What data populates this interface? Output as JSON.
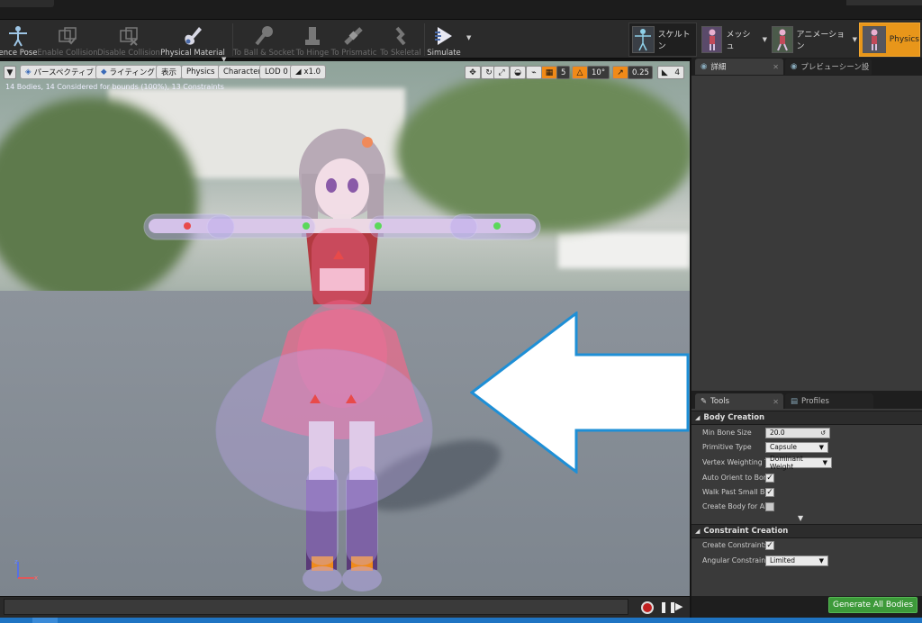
{
  "toolbar": {
    "items": [
      {
        "label": "ence Pose",
        "icon": "reference-pose-icon",
        "enabled": true
      },
      {
        "label": "Enable Collision",
        "icon": "enable-collision-icon",
        "enabled": false
      },
      {
        "label": "Disable Collision",
        "icon": "disable-collision-icon",
        "enabled": false
      },
      {
        "label": "Physical Material",
        "icon": "physical-material-icon",
        "enabled": true
      },
      {
        "label": "To Ball & Socket",
        "icon": "ball-socket-icon",
        "enabled": false
      },
      {
        "label": "To Hinge",
        "icon": "hinge-icon",
        "enabled": false
      },
      {
        "label": "To Prismatic",
        "icon": "prismatic-icon",
        "enabled": false
      },
      {
        "label": "To Skeletal",
        "icon": "skeletal-icon",
        "enabled": false
      },
      {
        "label": "Simulate",
        "icon": "simulate-icon",
        "enabled": true
      }
    ],
    "modes": [
      {
        "label": "スケルトン",
        "icon": "skeleton-mode-icon"
      },
      {
        "label": "メッシュ",
        "icon": "mesh-mode-icon"
      },
      {
        "label": "アニメーション",
        "icon": "animation-mode-icon"
      },
      {
        "label": "Physics",
        "icon": "physics-mode-icon",
        "active": true
      }
    ]
  },
  "viewport": {
    "left_buttons": [
      "パースペクティブ",
      "ライティング",
      "表示",
      "Physics",
      "Character",
      "LOD 0",
      "x1.0"
    ],
    "grid_snap": "5",
    "rotation_snap": "10°",
    "scale_snap": "0.25",
    "camera_speed": "4",
    "stats": "14 Bodies, 14 Considered for bounds (100%), 13 Constraints"
  },
  "panels": {
    "top_tabs": [
      "詳細",
      "プレビューシーン設"
    ],
    "bottom_tabs": [
      "Tools",
      "Profiles"
    ]
  },
  "body_creation": {
    "title": "Body Creation",
    "min_bone_size_label": "Min Bone Size",
    "min_bone_size": "20.0",
    "primitive_type_label": "Primitive Type",
    "primitive_type": "Capsule",
    "vertex_weighting_label": "Vertex Weighting Type",
    "vertex_weighting": "Dominant Weight",
    "auto_orient_label": "Auto Orient to Bone",
    "auto_orient": true,
    "walk_past_label": "Walk Past Small Bones",
    "walk_past": true,
    "create_body_all_label": "Create Body for All Bones",
    "create_body_all": false
  },
  "constraint_creation": {
    "title": "Constraint Creation",
    "create_constraints_label": "Create Constraints",
    "create_constraints": true,
    "angular_label": "Angular Constraint Mode",
    "angular_mode": "Limited"
  },
  "generate_button": "Generate All Bodies",
  "colors": {
    "accent_orange": "#e8961a",
    "generate_green": "#3d9a3a",
    "arrow_outline": "#1e8fd6",
    "status_blue": "#1f74c3"
  }
}
